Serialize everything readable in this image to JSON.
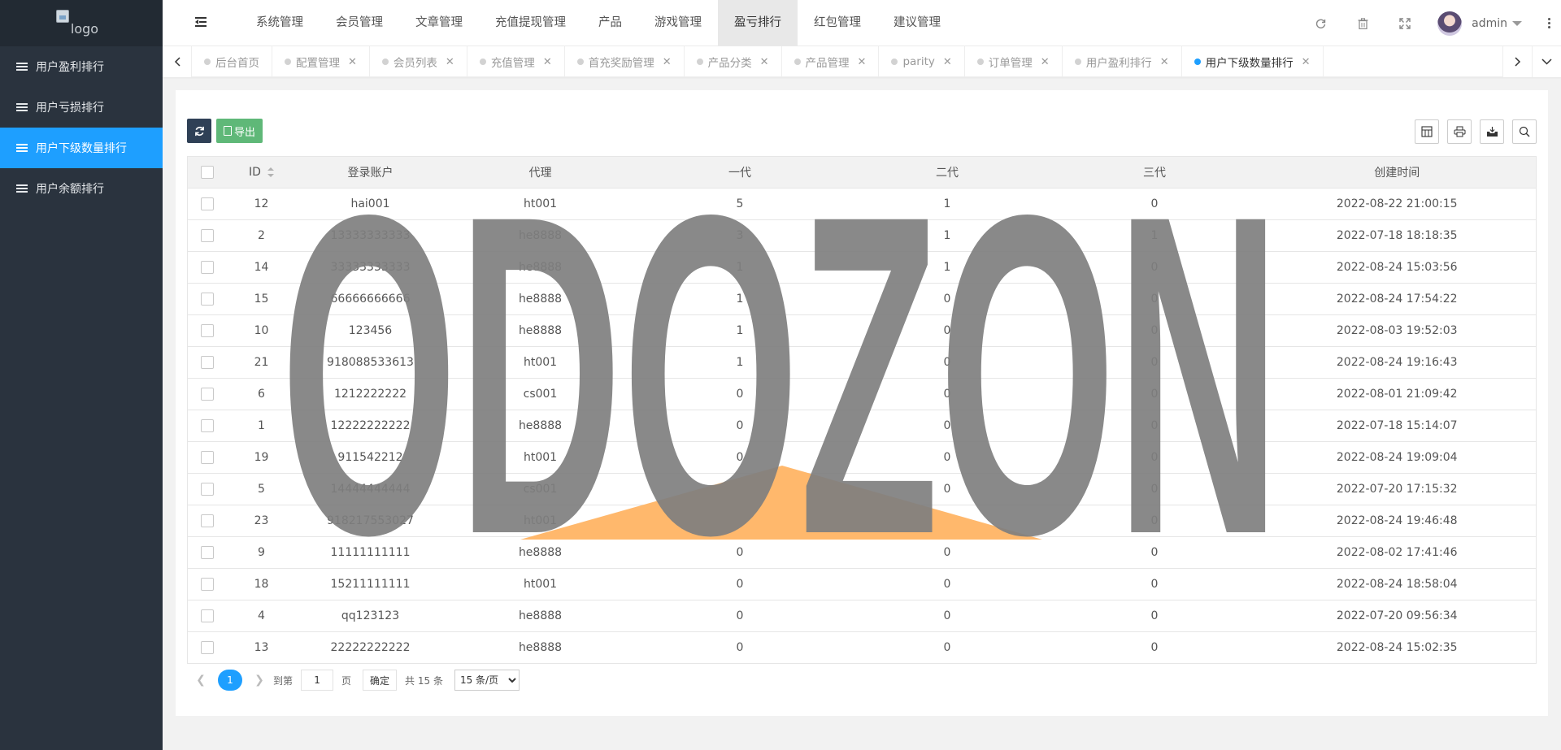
{
  "sidebar": {
    "logo_alt": "logo",
    "items": [
      {
        "label": "用户盈利排行",
        "active": false
      },
      {
        "label": "用户亏损排行",
        "active": false
      },
      {
        "label": "用户下级数量排行",
        "active": true
      },
      {
        "label": "用户余额排行",
        "active": false
      }
    ]
  },
  "header": {
    "nav": [
      {
        "label": "系统管理",
        "active": false
      },
      {
        "label": "会员管理",
        "active": false
      },
      {
        "label": "文章管理",
        "active": false
      },
      {
        "label": "充值提现管理",
        "active": false
      },
      {
        "label": "产品",
        "active": false
      },
      {
        "label": "游戏管理",
        "active": false
      },
      {
        "label": "盈亏排行",
        "active": true
      },
      {
        "label": "红包管理",
        "active": false
      },
      {
        "label": "建议管理",
        "active": false
      }
    ],
    "user_name": "admin"
  },
  "tabs": [
    {
      "label": "后台首页",
      "closable": false,
      "active": false
    },
    {
      "label": "配置管理",
      "closable": true,
      "active": false
    },
    {
      "label": "会员列表",
      "closable": true,
      "active": false
    },
    {
      "label": "充值管理",
      "closable": true,
      "active": false
    },
    {
      "label": "首充奖励管理",
      "closable": true,
      "active": false
    },
    {
      "label": "产品分类",
      "closable": true,
      "active": false
    },
    {
      "label": "产品管理",
      "closable": true,
      "active": false
    },
    {
      "label": "parity",
      "closable": true,
      "active": false
    },
    {
      "label": "订单管理",
      "closable": true,
      "active": false
    },
    {
      "label": "用户盈利排行",
      "closable": true,
      "active": false
    },
    {
      "label": "用户下级数量排行",
      "closable": true,
      "active": true
    }
  ],
  "toolbar": {
    "export_label": "导出"
  },
  "table": {
    "columns": [
      "ID",
      "登录账户",
      "代理",
      "一代",
      "二代",
      "三代",
      "创建时间"
    ],
    "rows": [
      [
        "12",
        "hai001",
        "ht001",
        "5",
        "1",
        "0",
        "2022-08-22 21:00:15"
      ],
      [
        "2",
        "13333333333",
        "he8888",
        "3",
        "1",
        "1",
        "2022-07-18 18:18:35"
      ],
      [
        "14",
        "33333333333",
        "he8888",
        "1",
        "1",
        "0",
        "2022-08-24 15:03:56"
      ],
      [
        "15",
        "66666666666",
        "he8888",
        "1",
        "0",
        "0",
        "2022-08-24 17:54:22"
      ],
      [
        "10",
        "123456",
        "he8888",
        "1",
        "0",
        "0",
        "2022-08-03 19:52:03"
      ],
      [
        "21",
        "918088533613",
        "ht001",
        "1",
        "0",
        "0",
        "2022-08-24 19:16:43"
      ],
      [
        "6",
        "1212222222",
        "cs001",
        "0",
        "0",
        "0",
        "2022-08-01 21:09:42"
      ],
      [
        "1",
        "12222222222",
        "he8888",
        "0",
        "0",
        "0",
        "2022-07-18 15:14:07"
      ],
      [
        "19",
        "911542212",
        "ht001",
        "0",
        "0",
        "0",
        "2022-08-24 19:09:04"
      ],
      [
        "5",
        "14444444444",
        "cs001",
        "0",
        "0",
        "0",
        "2022-07-20 17:15:32"
      ],
      [
        "23",
        "918217553027",
        "ht001",
        "0",
        "0",
        "0",
        "2022-08-24 19:46:48"
      ],
      [
        "9",
        "11111111111",
        "he8888",
        "0",
        "0",
        "0",
        "2022-08-02 17:41:46"
      ],
      [
        "18",
        "15211111111",
        "ht001",
        "0",
        "0",
        "0",
        "2022-08-24 18:58:04"
      ],
      [
        "4",
        "qq123123",
        "he8888",
        "0",
        "0",
        "0",
        "2022-07-20 09:56:34"
      ],
      [
        "13",
        "22222222222",
        "he8888",
        "0",
        "0",
        "0",
        "2022-08-24 15:02:35"
      ]
    ]
  },
  "pager": {
    "current": "1",
    "goto_label": "到第",
    "page_input": "1",
    "page_unit": "页",
    "confirm_label": "确定",
    "total_label": "共 15 条",
    "page_size_option": "15 条/页"
  },
  "watermark": {
    "text": "ODOZON",
    "letter_color": "#7f7f7f",
    "triangle_color": "#ffb86c"
  },
  "colors": {
    "sidebar_bg": "#2a333e",
    "active_blue": "#1e9fff",
    "export_green": "#5fb878",
    "refresh_dark": "#2f4056"
  }
}
